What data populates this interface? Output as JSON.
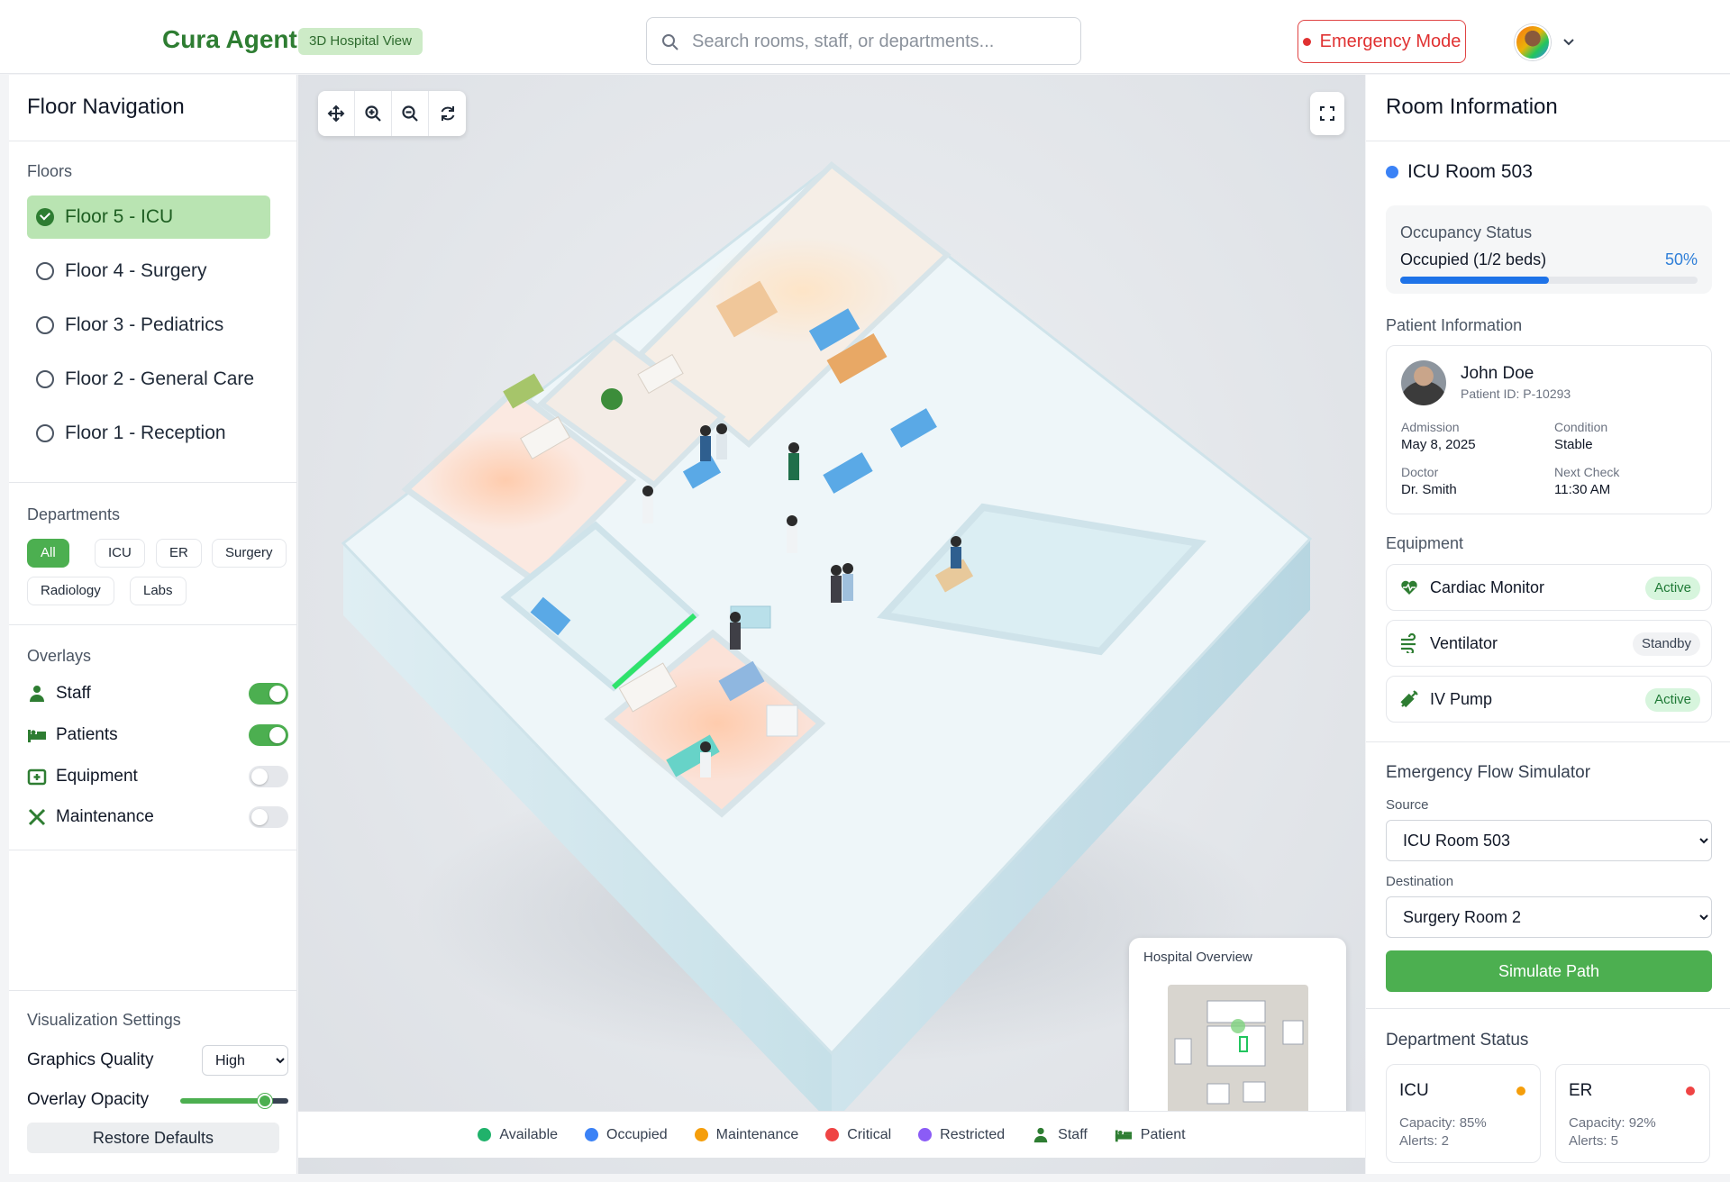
{
  "header": {
    "brand": "Cura Agent",
    "badge": "3D Hospital View",
    "search_placeholder": "Search rooms, staff, or departments...",
    "emergency_label": "Emergency Mode"
  },
  "left": {
    "title": "Floor Navigation",
    "floors_label": "Floors",
    "floors": [
      {
        "label": "Floor 5 - ICU",
        "selected": true
      },
      {
        "label": "Floor 4 - Surgery",
        "selected": false
      },
      {
        "label": "Floor 3 - Pediatrics",
        "selected": false
      },
      {
        "label": "Floor 2 - General Care",
        "selected": false
      },
      {
        "label": "Floor 1 - Reception",
        "selected": false
      }
    ],
    "departments_label": "Departments",
    "departments": [
      "All",
      "ICU",
      "ER",
      "Surgery",
      "Radiology",
      "Labs"
    ],
    "overlays_label": "Overlays",
    "overlays": [
      {
        "label": "Staff",
        "icon": "staff-icon",
        "on": true
      },
      {
        "label": "Patients",
        "icon": "patient-bed-icon",
        "on": true
      },
      {
        "label": "Equipment",
        "icon": "equipment-icon",
        "on": false
      },
      {
        "label": "Maintenance",
        "icon": "tools-icon",
        "on": false
      }
    ],
    "settings_label": "Visualization Settings",
    "graphics_quality_label": "Graphics Quality",
    "graphics_quality_value": "High",
    "overlay_opacity_label": "Overlay Opacity",
    "overlay_opacity_value": 0.78,
    "restore_label": "Restore Defaults"
  },
  "view": {
    "overview_title": "Hospital Overview",
    "legend": [
      {
        "label": "Available",
        "color": "#20b26b"
      },
      {
        "label": "Occupied",
        "color": "#3b82f6"
      },
      {
        "label": "Maintenance",
        "color": "#f59e0b"
      },
      {
        "label": "Critical",
        "color": "#ef4444"
      },
      {
        "label": "Restricted",
        "color": "#8b5cf6"
      },
      {
        "label": "Staff",
        "icon": "staff-icon"
      },
      {
        "label": "Patient",
        "icon": "patient-bed-icon"
      }
    ]
  },
  "right": {
    "title": "Room Information",
    "room_name": "ICU Room 503",
    "occupancy_label": "Occupancy Status",
    "occupancy_value": "Occupied (1/2 beds)",
    "occupancy_pct": "50%",
    "occupancy_fraction": 0.5,
    "patient_label": "Patient Information",
    "patient": {
      "name": "John Doe",
      "id": "Patient ID: P-10293",
      "admission_label": "Admission",
      "admission": "May 8, 2025",
      "condition_label": "Condition",
      "condition": "Stable",
      "doctor_label": "Doctor",
      "doctor": "Dr. Smith",
      "next_check_label": "Next Check",
      "next_check": "11:30 AM"
    },
    "equipment_label": "Equipment",
    "equipment": [
      {
        "name": "Cardiac Monitor",
        "status": "Active",
        "icon": "heart-monitor-icon"
      },
      {
        "name": "Ventilator",
        "status": "Standby",
        "icon": "ventilator-icon"
      },
      {
        "name": "IV Pump",
        "status": "Active",
        "icon": "syringe-icon"
      }
    ],
    "sim_title": "Emergency Flow Simulator",
    "source_label": "Source",
    "source_value": "ICU Room 503",
    "dest_label": "Destination",
    "dest_value": "Surgery Room 2",
    "simulate_label": "Simulate Path",
    "dept_status_label": "Department Status",
    "dept_status": [
      {
        "name": "ICU",
        "capacity": "Capacity: 85%",
        "alerts": "Alerts: 2",
        "color": "#f59e0b"
      },
      {
        "name": "ER",
        "capacity": "Capacity: 92%",
        "alerts": "Alerts: 5",
        "color": "#ef4444"
      }
    ]
  }
}
